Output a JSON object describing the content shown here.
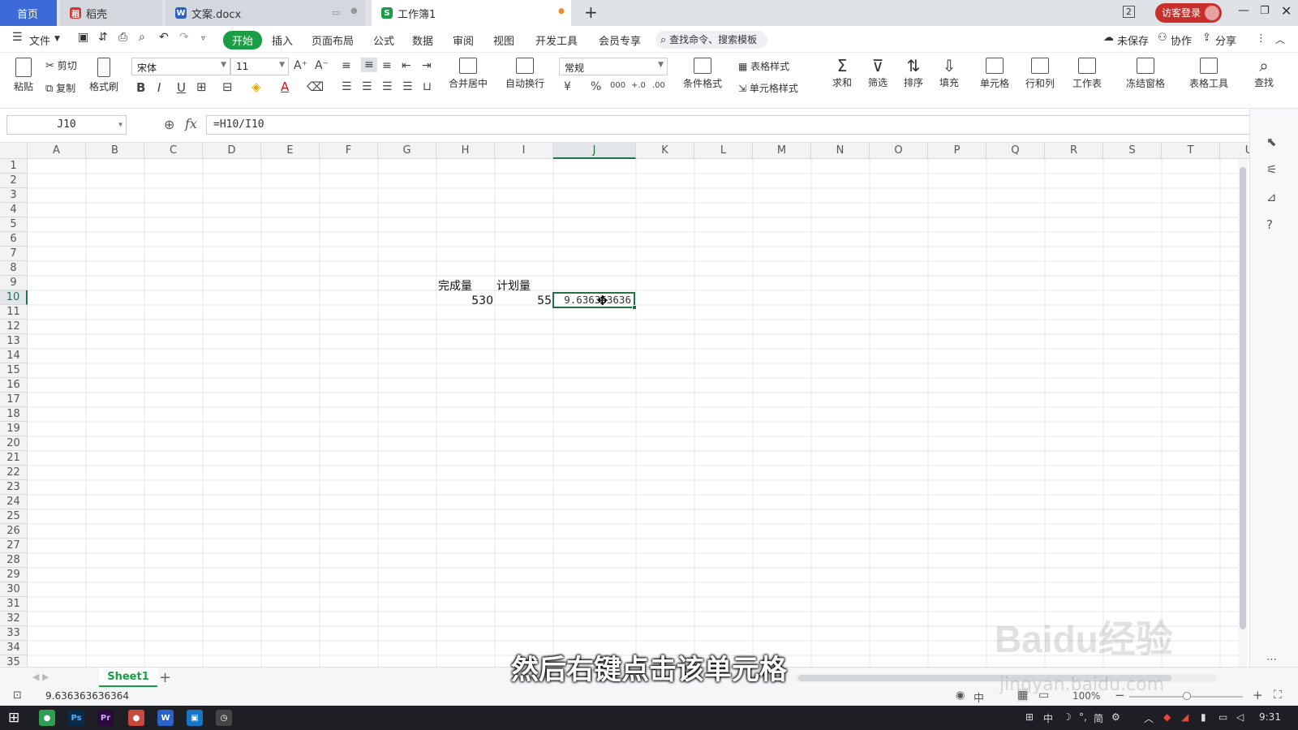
{
  "tabs": {
    "home": "首页",
    "docer": "稻壳",
    "doc": "文案.docx",
    "sheet": "工作簿1",
    "new_tab": "+",
    "page_count": "2",
    "login": "访客登录"
  },
  "menu": {
    "file": "文件",
    "items": [
      "开始",
      "插入",
      "页面布局",
      "公式",
      "数据",
      "审阅",
      "视图",
      "开发工具",
      "会员专享"
    ],
    "search": "查找命令、搜索模板",
    "unsaved": "未保存",
    "collab": "协作",
    "share": "分享"
  },
  "ribbon": {
    "paste": "粘贴",
    "cut": "剪切",
    "copy": "复制",
    "format_painter": "格式刷",
    "font": "宋体",
    "size": "11",
    "bold": "B",
    "italic": "I",
    "underline": "U",
    "font_color_glyph": "A",
    "merge": "合并居中",
    "wrap": "自动换行",
    "number_format": "常规",
    "currency": "¥",
    "percent": "%",
    "thousands": "000",
    "inc_dec": "+.0",
    "dec_dec": ".00",
    "cond_format": "条件格式",
    "table_style": "表格样式",
    "cell_style": "单元格样式",
    "sum": "求和",
    "filter": "筛选",
    "sort": "排序",
    "fill": "填充",
    "cell": "单元格",
    "row_col": "行和列",
    "worksheet": "工作表",
    "freeze": "冻结窗格",
    "table_tools": "表格工具",
    "find": "查找"
  },
  "formula_bar": {
    "name_box": "J10",
    "fx": "fx",
    "formula": "=H10/I10"
  },
  "columns": [
    "A",
    "B",
    "C",
    "D",
    "E",
    "F",
    "G",
    "H",
    "I",
    "J",
    "K",
    "L",
    "M",
    "N",
    "O",
    "P",
    "Q",
    "R",
    "S",
    "T",
    "U"
  ],
  "rows": [
    "1",
    "2",
    "3",
    "4",
    "5",
    "6",
    "7",
    "8",
    "9",
    "10",
    "11",
    "12",
    "13",
    "14",
    "15",
    "16",
    "17",
    "18",
    "19",
    "20",
    "21",
    "22",
    "23",
    "24",
    "25",
    "26",
    "27",
    "28",
    "29",
    "30",
    "31",
    "32",
    "33",
    "34",
    "35"
  ],
  "cells": {
    "H9": "完成量",
    "I9": "计划量",
    "H10": "530",
    "I10": "55",
    "J10": "9.636363636"
  },
  "selected_cell": "J10",
  "sheet_tab": "Sheet1",
  "add_sheet": "+",
  "status": {
    "value": "9.636363636364",
    "zoom": "100%",
    "ime": "中"
  },
  "subtitle": "然后右键点击该单元格",
  "watermark": {
    "logo": "Baidu经验",
    "url": "jingyan.baidu.com"
  },
  "taskbar": {
    "time": "9:31",
    "ime1": "中",
    "ime2": "简"
  },
  "colors": {
    "accent": "#1a9e45",
    "selection": "#217346",
    "login_bg": "#c9302c"
  }
}
